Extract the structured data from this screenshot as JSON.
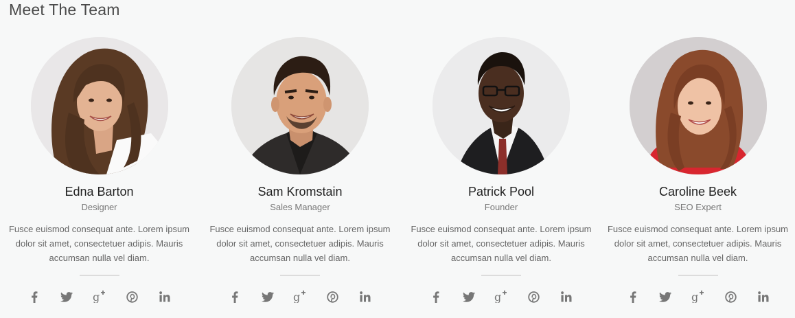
{
  "section": {
    "title": "Meet The Team"
  },
  "members": [
    {
      "name": "Edna Barton",
      "role": "Designer",
      "bio": "Fusce euismod consequat ante. Lorem ipsum dolor sit amet, consectetuer adipis. Mauris accumsan nulla vel diam."
    },
    {
      "name": "Sam Kromstain",
      "role": "Sales Manager",
      "bio": "Fusce euismod consequat ante. Lorem ipsum dolor sit amet, consectetuer adipis. Mauris accumsan nulla vel diam."
    },
    {
      "name": "Patrick Pool",
      "role": "Founder",
      "bio": "Fusce euismod consequat ante. Lorem ipsum dolor sit amet, consectetuer adipis. Mauris accumsan nulla vel diam."
    },
    {
      "name": "Caroline Beek",
      "role": "SEO Expert",
      "bio": "Fusce euismod consequat ante. Lorem ipsum dolor sit amet, consectetuer adipis. Mauris accumsan nulla vel diam."
    }
  ],
  "social_icons": [
    "facebook-icon",
    "twitter-icon",
    "google-plus-icon",
    "pinterest-icon",
    "linkedin-icon"
  ],
  "colors": {
    "background": "#f7f8f8",
    "icon": "#777777",
    "divider": "#dcdcdc"
  }
}
